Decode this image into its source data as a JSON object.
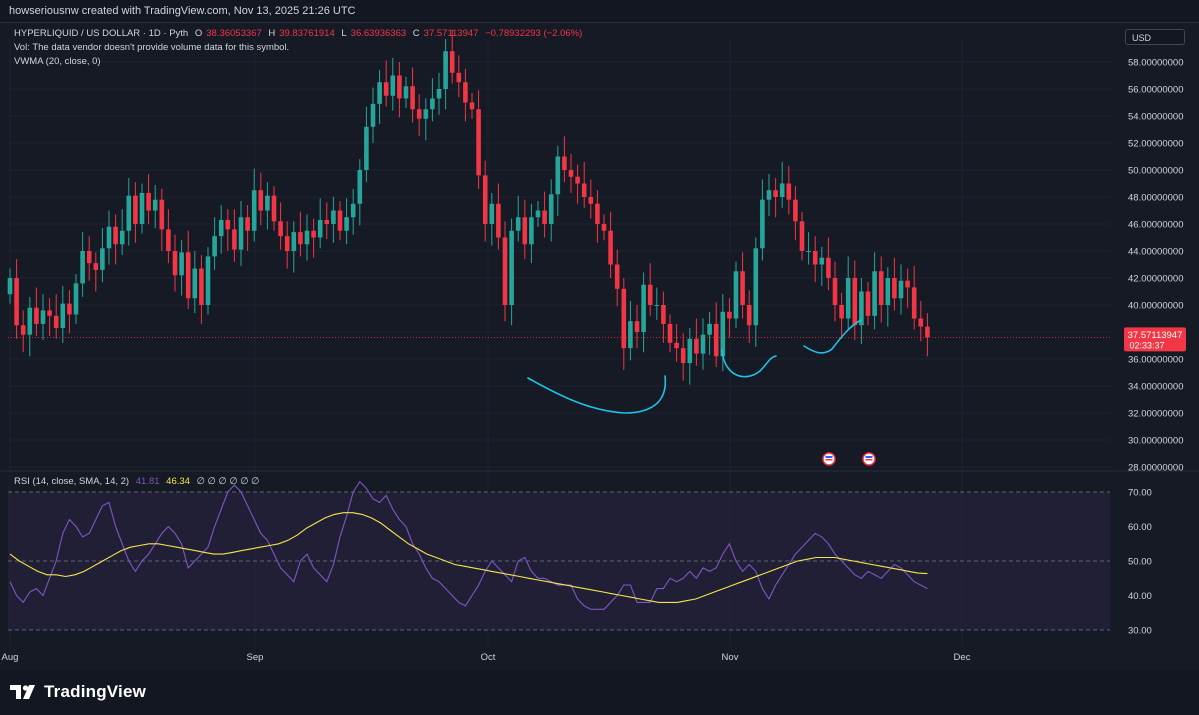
{
  "header": {
    "attribution": "howseriousnw created with TradingView.com, Nov 13, 2025 21:26 UTC"
  },
  "legend": {
    "symbol": "HYPERLIQUID / US DOLLAR · 1D · Pyth",
    "open": "38.36053367",
    "high": "39.83761914",
    "low": "36.63936363",
    "close": "37.57113947",
    "change": "−0.78932293 (−2.06%)",
    "vol_note": "Vol: The data vendor doesn't provide volume data for this symbol.",
    "vwma": "VWMA (20, close, 0)",
    "rsi_label": "RSI (14, close, SMA, 14, 2)",
    "rsi_value": "41.81",
    "rsi_sma_value": "46.34",
    "rsi_extra": "∅ ∅ ∅ ∅ ∅ ∅"
  },
  "currency_button": "USD",
  "price_tag": {
    "price": "37.57113947",
    "countdown": "02:33:37"
  },
  "footer": {
    "logo_text": "TradingView"
  },
  "colors": {
    "up": "#26a69a",
    "down": "#f23645",
    "rsi_line": "#7e57c2",
    "rsi_sma": "#f5e64a",
    "annotation": "#1fc2e8",
    "background": "#161a25"
  },
  "chart_data": [
    {
      "type": "candlestick",
      "ylim": [
        28,
        60
      ],
      "y_ticks": [
        "28.00000000",
        "30.00000000",
        "32.00000000",
        "34.00000000",
        "36.00000000",
        "38.00000000",
        "40.00000000",
        "42.00000000",
        "44.00000000",
        "46.00000000",
        "48.00000000",
        "50.00000000",
        "52.00000000",
        "54.00000000",
        "56.00000000",
        "58.00000000"
      ],
      "x_ticks": [
        "Aug",
        "Sep",
        "Oct",
        "Nov",
        "Dec"
      ],
      "closes": [
        42.0,
        38.5,
        37.8,
        39.8,
        38.6,
        39.6,
        39.2,
        38.3,
        40.1,
        39.3,
        41.6,
        44.0,
        43.1,
        42.6,
        44.2,
        45.8,
        44.5,
        45.5,
        48.1,
        46.0,
        48.3,
        47.0,
        47.8,
        45.6,
        44.0,
        42.2,
        43.9,
        40.5,
        42.7,
        40.0,
        43.6,
        45.1,
        46.3,
        45.6,
        44.1,
        46.5,
        45.5,
        48.5,
        47.0,
        48.1,
        46.2,
        45.1,
        44.0,
        45.4,
        44.5,
        45.5,
        45.0,
        46.3,
        46.0,
        47.0,
        45.5,
        46.5,
        47.5,
        50.0,
        53.2,
        54.9,
        56.5,
        55.5,
        57.0,
        55.3,
        56.2,
        54.5,
        53.8,
        54.5,
        55.3,
        56.0,
        58.8,
        57.2,
        56.5,
        55.0,
        54.5,
        49.6,
        46.0,
        47.5,
        45.0,
        40.0,
        45.5,
        46.5,
        44.5,
        46.5,
        47.0,
        46.0,
        48.2,
        51.0,
        50.0,
        49.5,
        49.0,
        48.0,
        47.5,
        46.0,
        45.5,
        43.0,
        41.2,
        36.8,
        38.8,
        38.0,
        41.5,
        40.0,
        40.0,
        38.6,
        37.2,
        36.8,
        35.7,
        37.5,
        36.4,
        37.8,
        38.6,
        36.2,
        39.5,
        39.0,
        42.5,
        40.0,
        38.5,
        44.2,
        47.8,
        48.5,
        48.0,
        49.0,
        47.8,
        46.2,
        44.0,
        44.0,
        43.0,
        43.5,
        42.0,
        40.0,
        39.0,
        42.0,
        38.5,
        41.0,
        39.2,
        42.5,
        40.0,
        42.0,
        40.5,
        41.8,
        41.3,
        39.0,
        38.4,
        37.6
      ],
      "annotations": [
        "rounded bottom",
        "rounded bottom",
        "upward curve"
      ]
    },
    {
      "type": "line",
      "name": "RSI (14, close, SMA, 14, 2)",
      "ylim": [
        25,
        75
      ],
      "y_ticks": [
        "30.00",
        "40.00",
        "50.00",
        "60.00",
        "70.00"
      ],
      "levels": [
        30,
        50,
        70
      ],
      "series": [
        {
          "name": "RSI",
          "values": [
            44,
            40,
            38,
            41,
            42,
            40,
            45,
            50,
            58,
            62,
            60,
            57,
            58,
            62,
            66,
            67,
            60,
            55,
            50,
            47,
            50,
            52,
            55,
            58,
            60,
            58,
            55,
            48,
            50,
            52,
            54,
            60,
            65,
            70,
            72,
            70,
            66,
            62,
            58,
            56,
            52,
            48,
            46,
            44,
            50,
            52,
            48,
            46,
            44,
            49,
            57,
            63,
            70,
            73,
            71,
            68,
            67,
            69,
            65,
            62,
            60,
            55,
            52,
            48,
            45,
            44,
            42,
            40,
            38,
            37,
            40,
            43,
            47,
            50,
            48,
            46,
            44,
            50,
            51,
            47,
            45,
            45,
            44,
            43,
            43,
            43,
            39,
            37,
            36,
            36,
            36,
            38,
            40,
            43,
            43,
            38,
            38,
            38,
            42,
            42,
            45,
            44,
            45,
            47,
            45,
            48,
            47,
            48,
            52,
            55,
            50,
            47,
            49,
            47,
            42,
            39,
            43,
            46,
            49,
            52,
            54,
            56,
            58,
            57,
            55,
            52,
            50,
            48,
            46,
            45,
            47,
            46,
            45,
            47,
            49,
            48,
            46,
            44,
            43,
            42
          ]
        },
        {
          "name": "SMA",
          "values": [
            52.0,
            50.0,
            48.5,
            47.0,
            46.0,
            46.0,
            45.5,
            46.0,
            47.0,
            48.5,
            50.0,
            51.5,
            53.0,
            54.0,
            54.5,
            55.0,
            55.0,
            54.5,
            54.0,
            53.5,
            53.0,
            52.5,
            52.0,
            52.0,
            52.5,
            53.0,
            53.5,
            54.0,
            54.5,
            55.0,
            56.0,
            57.5,
            59.5,
            61.0,
            62.5,
            63.5,
            64.0,
            64.0,
            63.5,
            62.5,
            61.0,
            59.0,
            57.0,
            55.0,
            53.5,
            52.0,
            51.0,
            50.0,
            49.0,
            48.5,
            48.0,
            47.5,
            47.0,
            46.5,
            46.0,
            45.5,
            45.0,
            44.5,
            44.0,
            43.5,
            43.0,
            42.5,
            42.0,
            41.5,
            41.0,
            40.5,
            40.0,
            39.5,
            39.0,
            38.5,
            38.0,
            38.0,
            38.0,
            38.5,
            39.0,
            40.0,
            41.0,
            42.0,
            43.0,
            44.0,
            45.0,
            46.0,
            47.0,
            48.0,
            49.0,
            50.0,
            50.5,
            51.0,
            51.0,
            51.0,
            50.5,
            50.0,
            49.5,
            49.0,
            48.5,
            48.0,
            47.5,
            47.0,
            46.5,
            46.34
          ]
        }
      ]
    }
  ]
}
